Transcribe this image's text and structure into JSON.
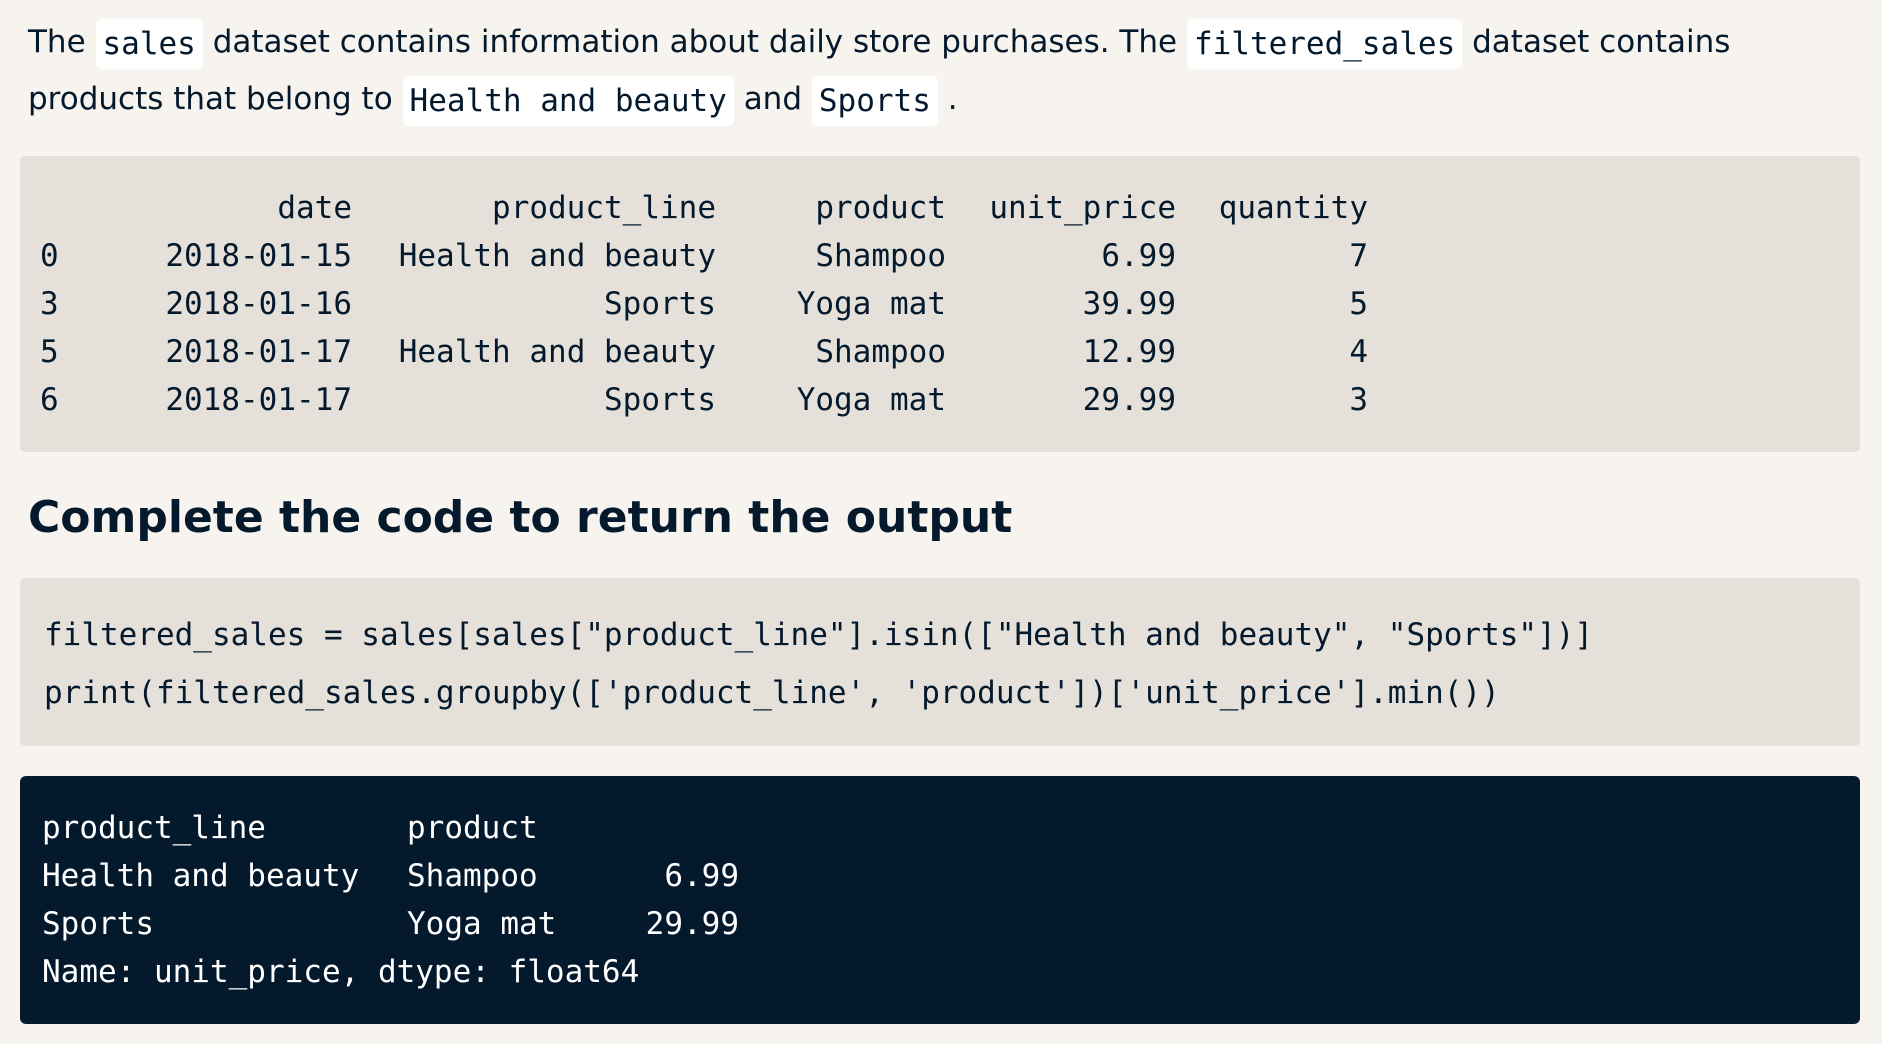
{
  "intro": {
    "part1": "The",
    "chip_sales": "sales",
    "part2": "dataset contains information about daily store purchases. The",
    "chip_filtered_sales": "filtered_sales",
    "part3": "dataset contains products that belong to",
    "chip_health": "Health and beauty",
    "part4": "and",
    "chip_sports": "Sports",
    "part5": "."
  },
  "dataset": {
    "columns": [
      "",
      "date",
      "product_line",
      "product",
      "unit_price",
      "quantity"
    ],
    "rows": [
      [
        "0",
        "2018-01-15",
        "Health and beauty",
        "Shampoo",
        "6.99",
        "7"
      ],
      [
        "3",
        "2018-01-16",
        "Sports",
        "Yoga mat",
        "39.99",
        "5"
      ],
      [
        "5",
        "2018-01-17",
        "Health and beauty",
        "Shampoo",
        "12.99",
        "4"
      ],
      [
        "6",
        "2018-01-17",
        "Sports",
        "Yoga mat",
        "29.99",
        "3"
      ]
    ]
  },
  "heading": "Complete the code to return the output",
  "code": {
    "lines": [
      "filtered_sales = sales[sales[\"product_line\"].isin([\"Health and beauty\", \"Sports\"])]",
      "print(filtered_sales.groupby(['product_line', 'product'])['unit_price'].min())"
    ]
  },
  "output": {
    "header": [
      "product_line",
      "product",
      ""
    ],
    "rows": [
      [
        "Health and beauty",
        "Shampoo",
        "6.99"
      ],
      [
        "Sports",
        "Yoga mat",
        "29.99"
      ]
    ],
    "footer": "Name: unit_price, dtype: float64"
  },
  "colors": {
    "page_background": "#f7f3ee",
    "code_background": "#e5e1da",
    "console_background": "#05192d",
    "text": "#05192d",
    "chip_background": "#ffffff"
  }
}
